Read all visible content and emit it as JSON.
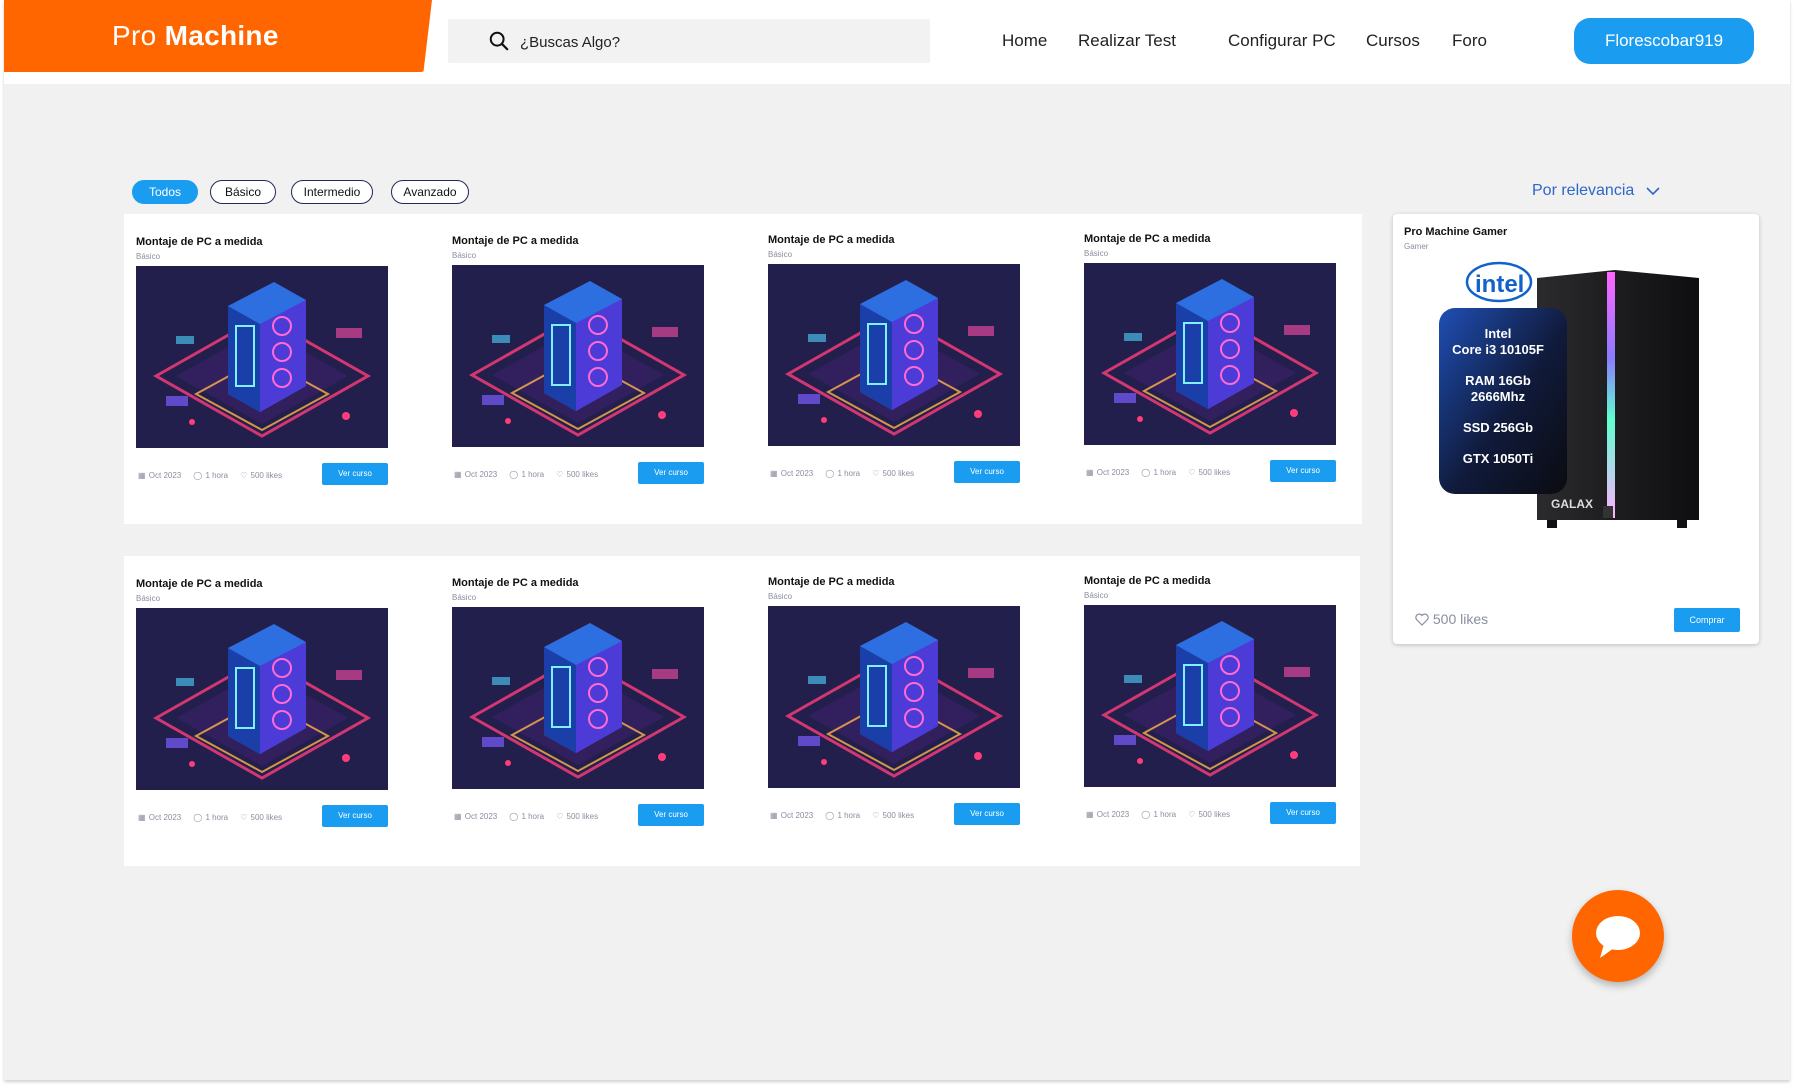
{
  "brand": {
    "light": "Pro",
    "bold": "Machine",
    "color": "#ff6600"
  },
  "search": {
    "placeholder": "¿Buscas Algo?",
    "icon": "search-icon"
  },
  "nav": {
    "items": [
      "Home",
      "Realizar Test",
      "Configurar PC",
      "Cursos",
      "Foro"
    ]
  },
  "user": {
    "name": "Florescobar919"
  },
  "filters": {
    "chips": [
      "Todos",
      "Básico",
      "Intermedio",
      "Avanzado"
    ],
    "active": "Todos"
  },
  "sort": {
    "label": "Por relevancia",
    "icon": "chevron-down-icon"
  },
  "courses": [
    {
      "title": "Montaje de PC a medida",
      "level": "Básico",
      "date": "Oct 2023",
      "duration": "1 hora",
      "likes": "500 likes",
      "button": "Ver curso"
    },
    {
      "title": "Montaje de PC a medida",
      "level": "Básico",
      "date": "Oct 2023",
      "duration": "1 hora",
      "likes": "500 likes",
      "button": "Ver curso"
    },
    {
      "title": "Montaje de PC a medida",
      "level": "Básico",
      "date": "Oct 2023",
      "duration": "1 hora",
      "likes": "500 likes",
      "button": "Ver curso"
    },
    {
      "title": "Montaje de PC a medida",
      "level": "Básico",
      "date": "Oct 2023",
      "duration": "1 hora",
      "likes": "500 likes",
      "button": "Ver curso"
    },
    {
      "title": "Montaje de PC a medida",
      "level": "Básico",
      "date": "Oct 2023",
      "duration": "1 hora",
      "likes": "500 likes",
      "button": "Ver curso"
    },
    {
      "title": "Montaje de PC a medida",
      "level": "Básico",
      "date": "Oct 2023",
      "duration": "1 hora",
      "likes": "500 likes",
      "button": "Ver curso"
    },
    {
      "title": "Montaje de PC a medida",
      "level": "Básico",
      "date": "Oct 2023",
      "duration": "1 hora",
      "likes": "500 likes",
      "button": "Ver curso"
    },
    {
      "title": "Montaje de PC a medida",
      "level": "Básico",
      "date": "Oct 2023",
      "duration": "1 hora",
      "likes": "500 likes",
      "button": "Ver curso"
    }
  ],
  "product": {
    "title": "Pro Machine Gamer",
    "category": "Gamer",
    "brand_logo": "intel",
    "case_brand": "GALAX",
    "specs": [
      "Intel",
      "Core i3 10105F",
      "RAM 16Gb",
      "2666Mhz",
      "SSD 256Gb",
      "GTX 1050Ti"
    ],
    "likes": "500 likes",
    "button": "Comprar"
  },
  "chat": {
    "icon": "chat-bubble-icon"
  },
  "colors": {
    "accent": "#1a9cf0",
    "brand": "#ff6600",
    "background": "#f1f1f1"
  }
}
